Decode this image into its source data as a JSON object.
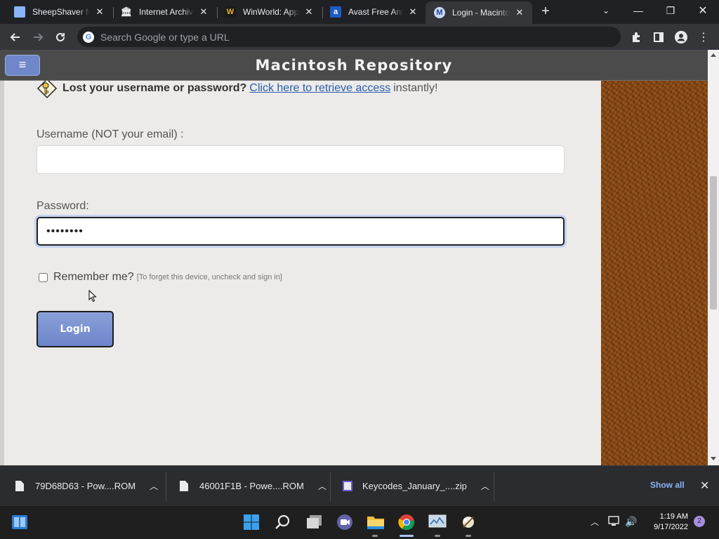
{
  "browser": {
    "tabs": [
      {
        "title": "SheepShaver for",
        "icon": "doc-icon",
        "active": false
      },
      {
        "title": "Internet Archive",
        "icon": "archive-icon",
        "active": false
      },
      {
        "title": "WinWorld: Appl",
        "icon": "winworld-icon",
        "active": false
      },
      {
        "title": "Avast Free Antiv",
        "icon": "avast-icon",
        "active": false
      },
      {
        "title": "Login - Macinto",
        "icon": "mac-repo-icon",
        "active": true
      }
    ],
    "omnibox_placeholder": "Search Google or type a URL"
  },
  "site": {
    "title": "Macintosh Repository"
  },
  "login": {
    "lost_bold": "Lost your username or password?",
    "lost_link": "Click here to retrieve access",
    "lost_tail": "instantly!",
    "username_label": "Username (NOT your email) :",
    "username_value": "",
    "password_label": "Password:",
    "password_value": "••••••••",
    "remember_label": "Remember me?",
    "remember_hint": "[To forget this device, uncheck and sign in]",
    "remember_checked": false,
    "login_button": "Login"
  },
  "downloads": {
    "items": [
      {
        "name": "79D68D63 - Pow....ROM"
      },
      {
        "name": "46001F1B - Powe....ROM"
      },
      {
        "name": "Keycodes_January_....zip"
      }
    ],
    "show_all": "Show all"
  },
  "taskbar": {
    "time": "1:19 AM",
    "date": "9/17/2022",
    "notifications": "2"
  },
  "colors": {
    "accent_button": "#6d86cc",
    "link": "#2a5db0",
    "header_bg": "#4b4b4b",
    "wood": "#8b4a17"
  }
}
